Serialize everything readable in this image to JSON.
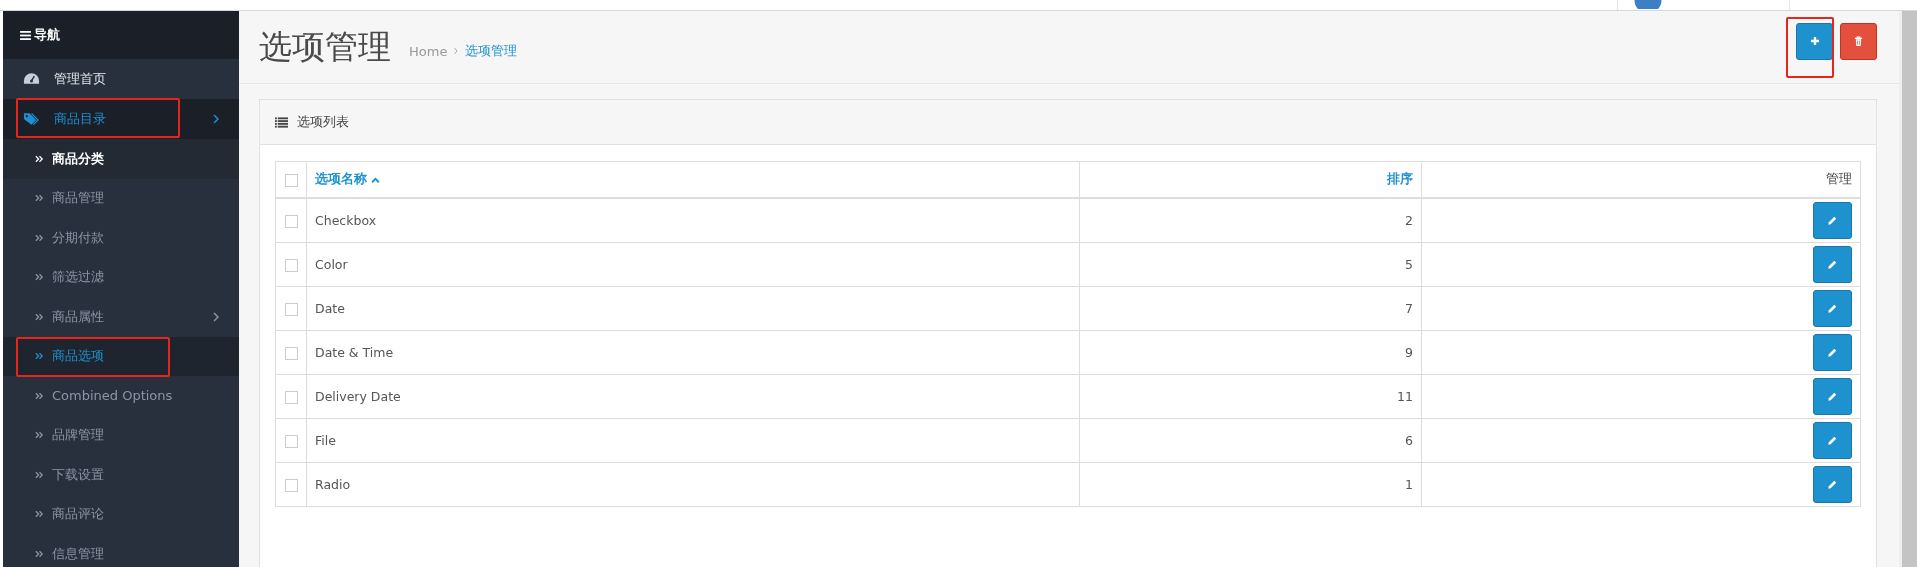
{
  "sidebar": {
    "title": "导航",
    "items": [
      {
        "label": "管理首页",
        "kind": "dashboard",
        "has_submenu": false,
        "expanded": false,
        "annotated": false
      },
      {
        "label": "商品目录",
        "kind": "tag",
        "has_submenu": true,
        "expanded": true,
        "annotated": true,
        "children": [
          {
            "label": "商品分类",
            "hovered": true,
            "selected": false,
            "has_submenu": false,
            "annotated": false
          },
          {
            "label": "商品管理",
            "hovered": false,
            "selected": false,
            "has_submenu": false,
            "annotated": false
          },
          {
            "label": "分期付款",
            "hovered": false,
            "selected": false,
            "has_submenu": false,
            "annotated": false
          },
          {
            "label": "筛选过滤",
            "hovered": false,
            "selected": false,
            "has_submenu": false,
            "annotated": false
          },
          {
            "label": "商品属性",
            "hovered": false,
            "selected": false,
            "has_submenu": true,
            "annotated": false
          },
          {
            "label": "商品选项",
            "hovered": false,
            "selected": true,
            "has_submenu": false,
            "annotated": true
          },
          {
            "label": "Combined Options",
            "hovered": false,
            "selected": false,
            "has_submenu": false,
            "annotated": false
          },
          {
            "label": "品牌管理",
            "hovered": false,
            "selected": false,
            "has_submenu": false,
            "annotated": false
          },
          {
            "label": "下载设置",
            "hovered": false,
            "selected": false,
            "has_submenu": false,
            "annotated": false
          },
          {
            "label": "商品评论",
            "hovered": false,
            "selected": false,
            "has_submenu": false,
            "annotated": false
          },
          {
            "label": "信息管理",
            "hovered": false,
            "selected": false,
            "has_submenu": false,
            "annotated": false
          }
        ]
      }
    ]
  },
  "page": {
    "title": "选项管理",
    "breadcrumb": [
      {
        "label": "Home",
        "current": false
      },
      {
        "label": "选项管理",
        "current": true
      }
    ],
    "buttons": [
      {
        "kind": "add",
        "annotated": true
      },
      {
        "kind": "delete",
        "annotated": false
      }
    ]
  },
  "panel": {
    "title": "选项列表"
  },
  "table": {
    "header_checked": false,
    "columns": [
      {
        "label": "选项名称",
        "kind": "link",
        "sorted": true
      },
      {
        "label": "排序",
        "kind": "link",
        "sorted": false
      },
      {
        "label": "管理",
        "kind": "plain",
        "sorted": false
      }
    ],
    "rows": [
      {
        "name": "Checkbox",
        "sort_order": "2",
        "checked": false
      },
      {
        "name": "Color",
        "sort_order": "5",
        "checked": false
      },
      {
        "name": "Date",
        "sort_order": "7",
        "checked": false
      },
      {
        "name": "Date & Time",
        "sort_order": "9",
        "checked": false
      },
      {
        "name": "Delivery Date",
        "sort_order": "11",
        "checked": false
      },
      {
        "name": "File",
        "sort_order": "6",
        "checked": false
      },
      {
        "name": "Radio",
        "sort_order": "1",
        "checked": false
      }
    ]
  }
}
